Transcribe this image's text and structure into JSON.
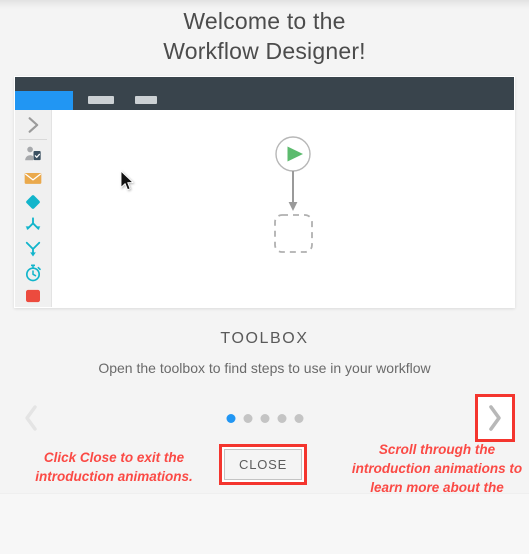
{
  "dialog": {
    "heading_line1": "Welcome to the",
    "heading_line2": "Workflow Designer!"
  },
  "app_preview": {
    "header": {
      "active_tab_label": "",
      "ghost_tab_1_label": "",
      "ghost_tab_2_label": ""
    },
    "toolbar": {
      "expand_label": "",
      "items": [
        {
          "name": "expand-toolbox-icon",
          "label": ""
        },
        {
          "name": "user-task-icon",
          "label": ""
        },
        {
          "name": "email-icon",
          "label": ""
        },
        {
          "name": "decision-diamond-icon",
          "label": ""
        },
        {
          "name": "branch-split-icon",
          "label": ""
        },
        {
          "name": "merge-join-icon",
          "label": ""
        },
        {
          "name": "timer-icon",
          "label": ""
        },
        {
          "name": "stop-icon",
          "label": ""
        }
      ]
    },
    "canvas": {
      "start_node_label": "",
      "placeholder_node_label": "",
      "cursor_label": ""
    }
  },
  "caption": {
    "title": "TOOLBOX",
    "subtitle": "Open the toolbox to find steps to use in your workflow"
  },
  "pager": {
    "prev_label": "",
    "next_label": "",
    "total_steps": 5,
    "current_step": 1
  },
  "annotations": {
    "left_text": "Click Close to exit the introduction animations.",
    "right_text": "Scroll through the introduction animations to learn more about the workflow designer.",
    "close_button_label": "CLOSE"
  },
  "colors": {
    "accent_blue": "#2196f3",
    "annotation_red": "#fb4a45",
    "highlight_border_red": "#f4352e",
    "app_header_dark": "#39444c",
    "start_green": "#5cbb6e",
    "tool_teal": "#12b5cb",
    "tool_orange": "#eaa94c",
    "tool_red": "#ec4b3e",
    "page_bg": "#f4f4f4"
  }
}
